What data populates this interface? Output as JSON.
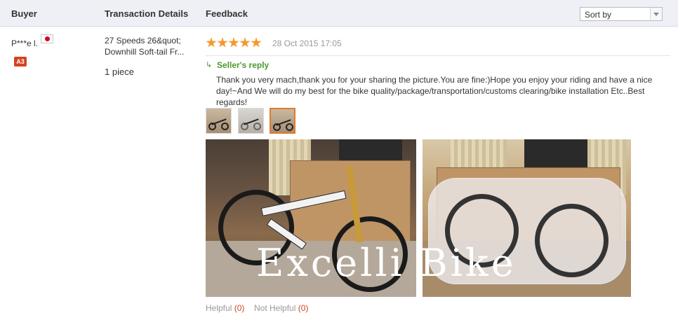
{
  "table": {
    "columns": {
      "buyer": "Buyer",
      "transaction": "Transaction Details",
      "feedback": "Feedback"
    },
    "sort": {
      "label": "Sort by"
    }
  },
  "review": {
    "buyer": {
      "name": "P***e l.",
      "country_flag": "japan-flag-icon",
      "level_badge": "A3"
    },
    "transaction": {
      "product": "27 Speeds 26&quot; Downhill Soft-tail Fr...",
      "quantity": "1 piece"
    },
    "rating": 5,
    "date": "28 Oct 2015 17:05",
    "seller_reply": {
      "label": "Seller's reply",
      "text": "Thank you very mach,thank you for your sharing the picture.You are fine:)Hope you enjoy your riding and have a nice day!~And We will do my best for the bike quality/package/transportation/customs clearing/bike installation Etc..Best regards!"
    },
    "watermark": "Excelli Bike",
    "helpful": {
      "label": "Helpful",
      "count": "(0)"
    },
    "not_helpful": {
      "label": "Not Helpful",
      "count": "(0)"
    }
  },
  "colors": {
    "accent": "#f49a2d",
    "reply_green": "#4c9a2a",
    "badge": "#d6421e"
  }
}
